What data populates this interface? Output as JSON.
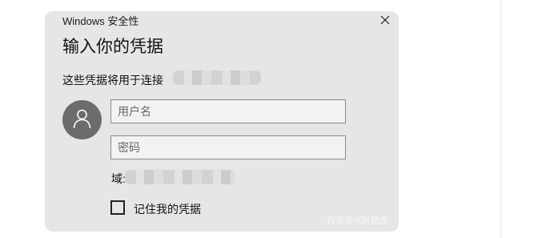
{
  "dialog": {
    "title": "Windows 安全性",
    "heading": "输入你的凭据",
    "subtext": "这些凭据将用于连接",
    "username_placeholder": "用户名",
    "password_placeholder": "密码",
    "domain_label": "域:",
    "remember_label": "记住我的凭据",
    "remember_checked": false
  },
  "icons": {
    "close": "close-icon",
    "user": "user-icon"
  },
  "watermark": "百家号/X阿昌虎",
  "colors": {
    "dialog_bg": "#e6e6e6",
    "avatar_bg": "#6c6c6c"
  }
}
